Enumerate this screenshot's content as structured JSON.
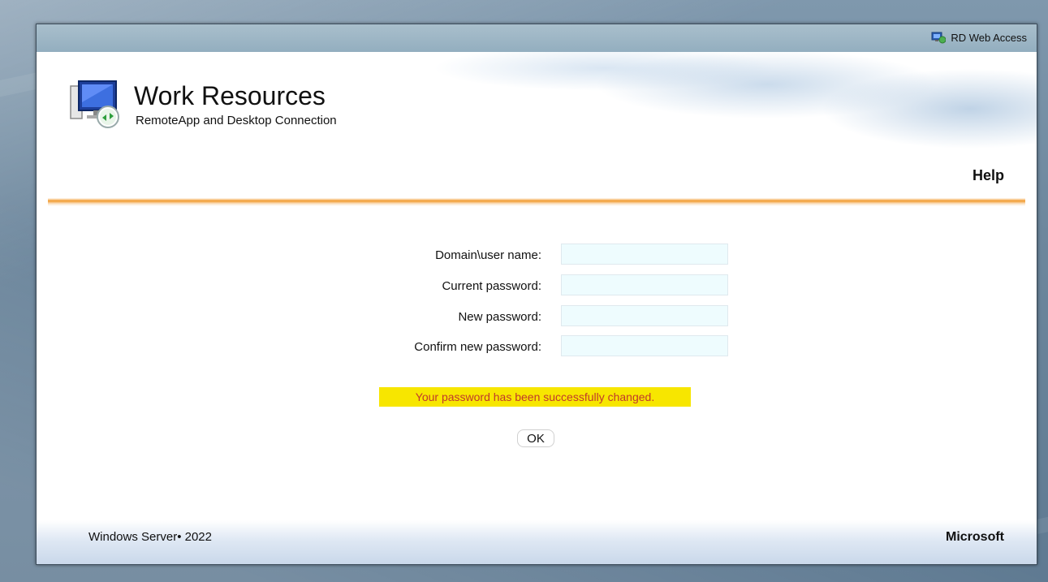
{
  "topbar": {
    "rd_web_access_label": "RD Web Access",
    "icon": "rd-web-access-icon"
  },
  "header": {
    "title": "Work Resources",
    "subtitle": "RemoteApp and Desktop Connection",
    "logo_icon": "remote-desktop-monitor-icon",
    "help_label": "Help"
  },
  "form": {
    "fields": [
      {
        "label": "Domain\\user name:",
        "value": ""
      },
      {
        "label": "Current password:",
        "value": ""
      },
      {
        "label": "New password:",
        "value": ""
      },
      {
        "label": "Confirm new password:",
        "value": ""
      }
    ]
  },
  "message": {
    "text": "Your password has been successfully changed.",
    "background": "#f7e600",
    "color": "#c0392b"
  },
  "ok_label": "OK",
  "footer": {
    "product": "Windows Server• 2022",
    "company": "Microsoft"
  },
  "colors": {
    "accent_rule": "#f29a2e",
    "topbar": "#9fb6c5",
    "input_bg": "#eefcfe"
  }
}
